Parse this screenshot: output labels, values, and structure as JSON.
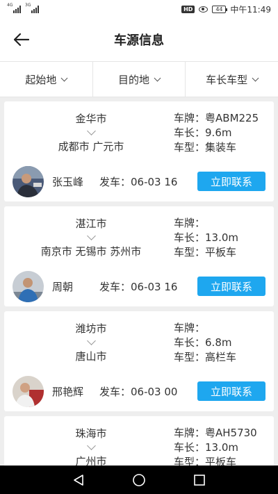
{
  "status_bar": {
    "signal_1_label": "4G",
    "signal_2_label": "3G",
    "hd_badge": "HD",
    "battery": "44",
    "time": "中午11:49"
  },
  "header": {
    "title": "车源信息"
  },
  "filters": [
    {
      "label": "起始地"
    },
    {
      "label": "目的地"
    },
    {
      "label": "车长车型"
    }
  ],
  "labels": {
    "plate": "车牌：",
    "length": "车长：",
    "type": "车型：",
    "depart": "发车：",
    "contact": "立即联系"
  },
  "cards": [
    {
      "from": "金华市",
      "to": "成都市 广元市",
      "plate": "粤ABM225",
      "length": "9.6m",
      "type": "集装车",
      "driver": "张玉峰",
      "depart": "06-03 16"
    },
    {
      "from": "湛江市",
      "to": "南京市 无锡市 苏州市",
      "plate": "",
      "length": "13.0m",
      "type": "平板车",
      "driver": "周朝",
      "depart": "06-03 16"
    },
    {
      "from": "潍坊市",
      "to": "唐山市",
      "plate": "",
      "length": "6.8m",
      "type": "高栏车",
      "driver": "邢艳辉",
      "depart": "06-03 00"
    },
    {
      "from": "珠海市",
      "to": "广州市",
      "plate": "粤AH5730",
      "length": "13.0m",
      "type": "平板车",
      "driver": "",
      "depart": ""
    }
  ],
  "colors": {
    "accent": "#1ea7ef",
    "background": "#eeeeee"
  }
}
